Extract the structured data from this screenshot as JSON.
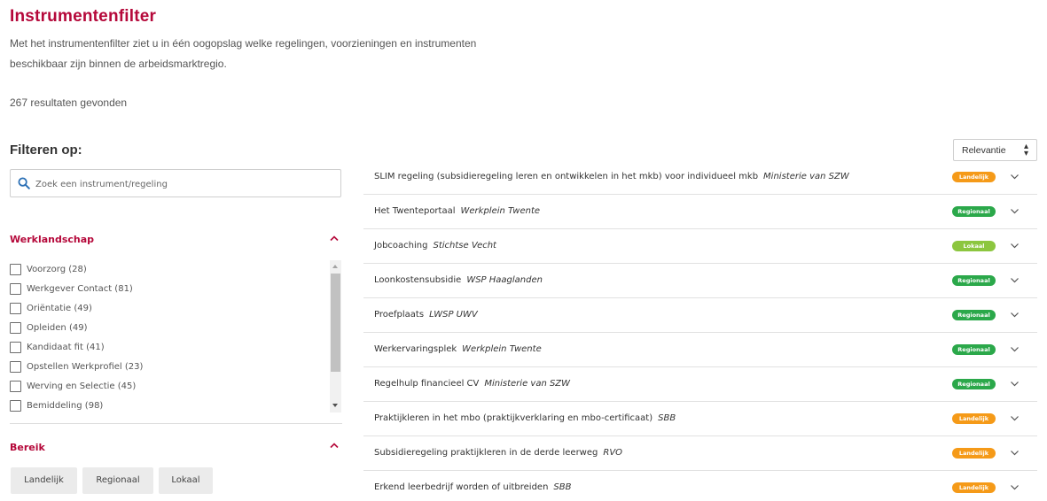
{
  "page": {
    "title": "Instrumentenfilter",
    "intro_line1": "Met het instrumentenfilter ziet u in één oogopslag welke regelingen, voorzieningen en instrumenten",
    "intro_line2": "beschikbaar zijn binnen de arbeidsmarktregio.",
    "result_count": "267 resultaten gevonden"
  },
  "filters": {
    "heading": "Filteren op:",
    "search_placeholder": "Zoek een instrument/regeling",
    "werklandschap": {
      "title": "Werklandschap",
      "items": [
        {
          "label": "Voorzorg (28)"
        },
        {
          "label": "Werkgever Contact (81)"
        },
        {
          "label": "Oriëntatie (49)"
        },
        {
          "label": "Opleiden (49)"
        },
        {
          "label": "Kandidaat fit (41)"
        },
        {
          "label": "Opstellen Werkprofiel (23)"
        },
        {
          "label": "Werving en Selectie (45)"
        },
        {
          "label": "Bemiddeling (98)"
        }
      ]
    },
    "bereik": {
      "title": "Bereik",
      "buttons": [
        "Landelijk",
        "Regionaal",
        "Lokaal"
      ]
    }
  },
  "sort": {
    "selected": "Relevantie"
  },
  "badge_colors": {
    "landelijk": "#f59a18",
    "regionaal": "#2ba84a",
    "lokaal": "#8cc63f"
  },
  "results": [
    {
      "name": "SLIM regeling (subsidieregeling leren en ontwikkelen in het mkb) voor individueel mkb",
      "org": "Ministerie van SZW",
      "badge": "Landelijk",
      "badge_type": "landelijk"
    },
    {
      "name": "Het Twenteportaal",
      "org": "Werkplein Twente",
      "badge": "Regionaal",
      "badge_type": "regionaal"
    },
    {
      "name": "Jobcoaching",
      "org": "Stichtse Vecht",
      "badge": "Lokaal",
      "badge_type": "lokaal"
    },
    {
      "name": "Loonkostensubsidie",
      "org": "WSP Haaglanden",
      "badge": "Regionaal",
      "badge_type": "regionaal"
    },
    {
      "name": "Proefplaats",
      "org": "LWSP UWV",
      "badge": "Regionaal",
      "badge_type": "regionaal"
    },
    {
      "name": "Werkervaringsplek",
      "org": "Werkplein Twente",
      "badge": "Regionaal",
      "badge_type": "regionaal"
    },
    {
      "name": "Regelhulp financieel CV",
      "org": "Ministerie van SZW",
      "badge": "Regionaal",
      "badge_type": "regionaal"
    },
    {
      "name": "Praktijkleren in het mbo (praktijkverklaring en mbo-certificaat)",
      "org": "SBB",
      "badge": "Landelijk",
      "badge_type": "landelijk"
    },
    {
      "name": "Subsidieregeling praktijkleren in de derde leerweg",
      "org": "RVO",
      "badge": "Landelijk",
      "badge_type": "landelijk"
    },
    {
      "name": "Erkend leerbedrijf worden of uitbreiden",
      "org": "SBB",
      "badge": "Landelijk",
      "badge_type": "landelijk"
    }
  ]
}
